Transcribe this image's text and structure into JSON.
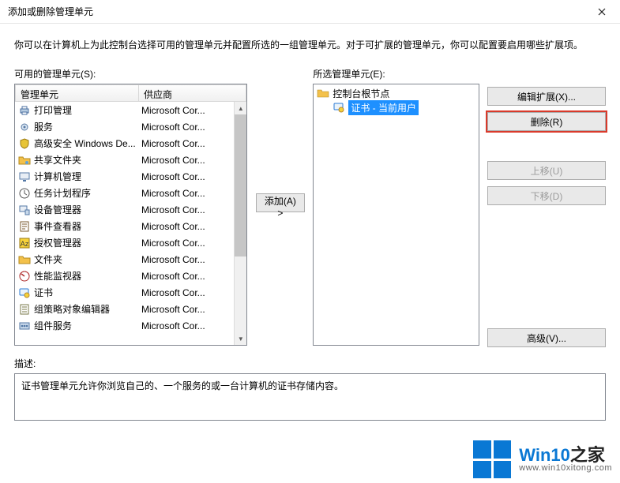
{
  "window": {
    "title": "添加或删除管理单元"
  },
  "intro": "你可以在计算机上为此控制台选择可用的管理单元并配置所选的一组管理单元。对于可扩展的管理单元，你可以配置要启用哪些扩展项。",
  "available": {
    "label": "可用的管理单元(S):",
    "columns": {
      "c1": "管理单元",
      "c2": "供应商"
    },
    "rows": [
      {
        "icon": "printer-icon",
        "name": "打印管理",
        "vendor": "Microsoft Cor..."
      },
      {
        "icon": "gear-icon",
        "name": "服务",
        "vendor": "Microsoft Cor..."
      },
      {
        "icon": "shield-icon",
        "name": "高级安全 Windows De...",
        "vendor": "Microsoft Cor..."
      },
      {
        "icon": "folder-share-icon",
        "name": "共享文件夹",
        "vendor": "Microsoft Cor..."
      },
      {
        "icon": "computer-mgmt-icon",
        "name": "计算机管理",
        "vendor": "Microsoft Cor..."
      },
      {
        "icon": "clock-icon",
        "name": "任务计划程序",
        "vendor": "Microsoft Cor..."
      },
      {
        "icon": "device-icon",
        "name": "设备管理器",
        "vendor": "Microsoft Cor..."
      },
      {
        "icon": "event-icon",
        "name": "事件查看器",
        "vendor": "Microsoft Cor..."
      },
      {
        "icon": "auth-icon",
        "name": "授权管理器",
        "vendor": "Microsoft Cor..."
      },
      {
        "icon": "folder-icon",
        "name": "文件夹",
        "vendor": "Microsoft Cor..."
      },
      {
        "icon": "perf-icon",
        "name": "性能监视器",
        "vendor": "Microsoft Cor..."
      },
      {
        "icon": "cert-icon",
        "name": "证书",
        "vendor": "Microsoft Cor..."
      },
      {
        "icon": "gpo-icon",
        "name": "组策略对象编辑器",
        "vendor": "Microsoft Cor..."
      },
      {
        "icon": "component-icon",
        "name": "组件服务",
        "vendor": "Microsoft Cor..."
      }
    ]
  },
  "selected": {
    "label": "所选管理单元(E):",
    "root": {
      "icon": "folder-root-icon",
      "label": "控制台根节点"
    },
    "child": {
      "icon": "cert-icon",
      "label": "证书 - 当前用户",
      "selected": true
    }
  },
  "buttons": {
    "add": "添加(A) >",
    "editExt": "编辑扩展(X)...",
    "remove": "删除(R)",
    "moveUp": "上移(U)",
    "moveDown": "下移(D)",
    "advanced": "高级(V)..."
  },
  "description": {
    "label": "描述:",
    "text": "证书管理单元允许你浏览自己的、一个服务的或一台计算机的证书存储内容。"
  },
  "watermark": {
    "brand_a": "Win10",
    "brand_b": "之家",
    "url": "www.win10xitong.com"
  }
}
